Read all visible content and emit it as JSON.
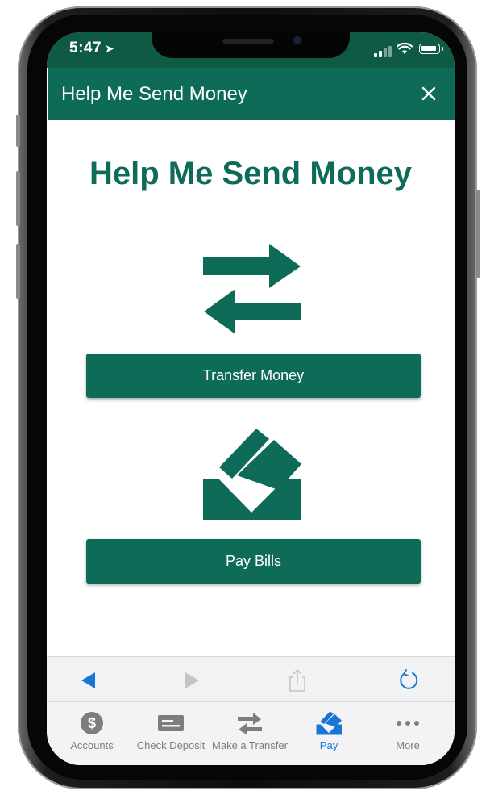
{
  "status_bar": {
    "time": "5:47",
    "location_glyph": "➤"
  },
  "header": {
    "title": "Help Me Send Money",
    "close_icon": "close-icon"
  },
  "main": {
    "heading": "Help Me Send Money",
    "transfer_button": "Transfer Money",
    "pay_bills_button": "Pay Bills"
  },
  "browser_toolbar": {
    "items": [
      "back-icon",
      "forward-icon",
      "share-icon",
      "refresh-icon"
    ]
  },
  "tab_bar": {
    "active_color": "#1877d6",
    "items": [
      {
        "label": "Accounts",
        "icon": "dollar-circle-icon"
      },
      {
        "label": "Check Deposit",
        "icon": "check-icon"
      },
      {
        "label": "Make a Transfer",
        "icon": "transfer-arrows-icon"
      },
      {
        "label": "Pay",
        "icon": "pay-envelope-icon"
      },
      {
        "label": "More",
        "icon": "more-dots-icon"
      }
    ]
  },
  "colors": {
    "brand": "#0e6b57",
    "status_bar": "#0e5a45"
  }
}
